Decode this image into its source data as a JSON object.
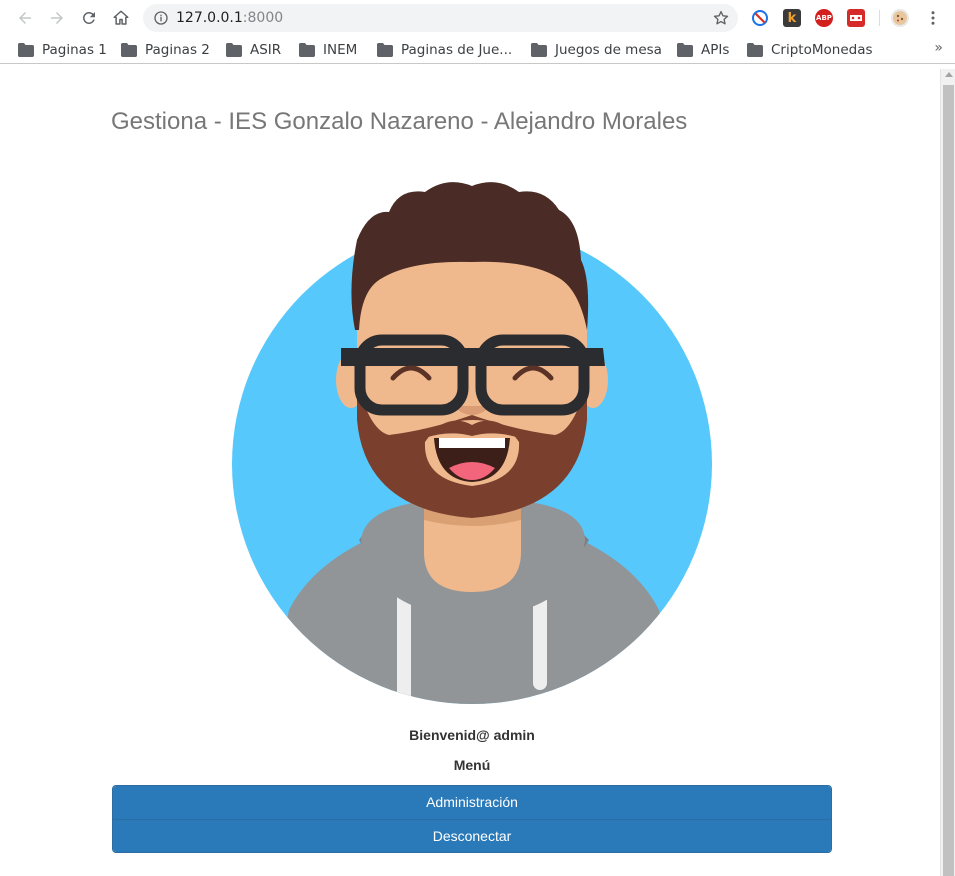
{
  "browser": {
    "url_host": "127.0.0.1",
    "url_port": ":8000",
    "icons": {
      "back": "arrow-left-icon",
      "forward": "arrow-right-icon",
      "reload": "reload-icon",
      "home": "home-icon",
      "info": "info-icon",
      "star": "star-icon",
      "menu": "kebab-menu-icon"
    },
    "extensions": [
      {
        "name": "block-extension-icon",
        "color": "#1a73e8"
      },
      {
        "name": "k-extension-icon",
        "label": "k",
        "color": "#3a3a3a"
      },
      {
        "name": "adblock-plus-icon",
        "label": "ABP",
        "color": "#d41f1f"
      },
      {
        "name": "red-extension-icon",
        "color": "#d62b2b"
      },
      {
        "name": "cookie-extension-icon",
        "color": "#e8c79f"
      }
    ]
  },
  "bookmarks": {
    "items": [
      {
        "label": "Paginas 1"
      },
      {
        "label": "Paginas 2"
      },
      {
        "label": "ASIR"
      },
      {
        "label": "INEM"
      },
      {
        "label": "Paginas de Jue..."
      },
      {
        "label": "Juegos de mesa"
      },
      {
        "label": "APIs"
      },
      {
        "label": "CriptoMonedas"
      }
    ],
    "more": "»"
  },
  "page": {
    "title": "Gestiona - IES Gonzalo Nazareno - Alejandro Morales",
    "welcome": "Bienvenid@ admin",
    "menu_title": "Menú",
    "menu_items": [
      {
        "label": "Administración"
      },
      {
        "label": "Desconectar"
      }
    ],
    "colors": {
      "avatar_background": "#57c8fb",
      "menu_button": "#2a7ab9",
      "title": "#777777"
    }
  }
}
